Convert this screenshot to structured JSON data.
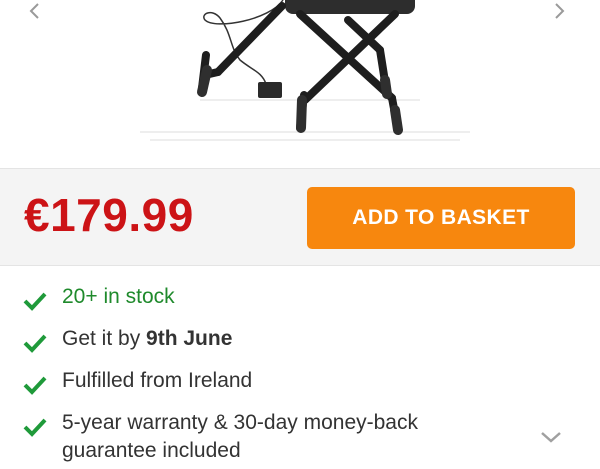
{
  "product": {
    "image_icon": "keyboard-bench-with-pedal"
  },
  "purchase": {
    "price": "€179.99",
    "add_to_basket_label": "ADD TO BASKET",
    "price_color": "#cc1316",
    "button_color": "#f7870e"
  },
  "features": {
    "stock": "20+ in stock",
    "delivery_prefix": "Get it by ",
    "delivery_date": "9th June",
    "fulfilment": "Fulfilled from Ireland",
    "warranty_line1": "5-year warranty & 30-day money-back",
    "warranty_line2": "guarantee included",
    "check_color": "#1f9a3a"
  },
  "icons": {
    "prev": "chevron-left-icon",
    "next": "chevron-right-icon",
    "expand": "chevron-down-icon",
    "check": "checkmark-icon"
  }
}
